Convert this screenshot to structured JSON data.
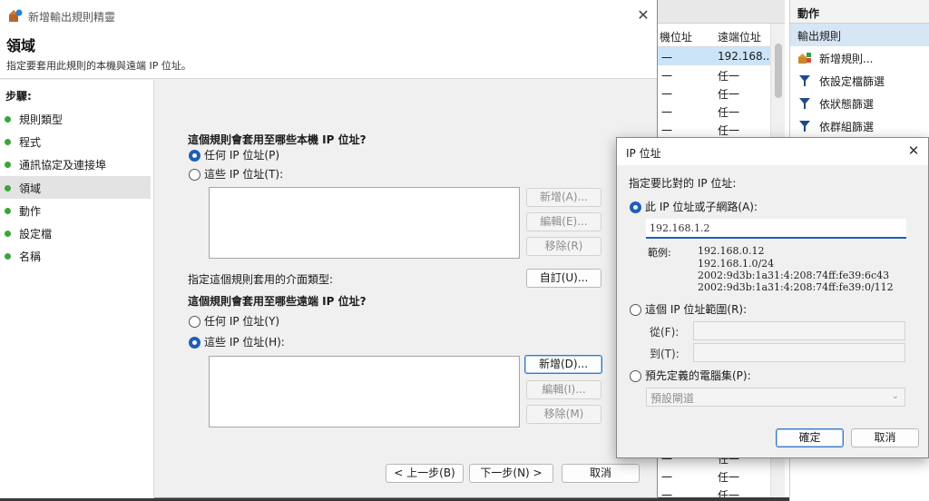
{
  "background": {
    "columns": [
      "機位址",
      "遠端位址"
    ],
    "rows": [
      {
        "local": "一",
        "remote": "192.168....",
        "selected": true
      },
      {
        "local": "一",
        "remote": "任一"
      },
      {
        "local": "一",
        "remote": "任一"
      },
      {
        "local": "一",
        "remote": "任一"
      },
      {
        "local": "一",
        "remote": "任一"
      }
    ],
    "bottom_rows": [
      {
        "local": "一",
        "remote": "任一"
      },
      {
        "local": "一",
        "remote": "任一"
      },
      {
        "local": "一",
        "remote": "任一"
      }
    ],
    "actions": {
      "title": "動作",
      "section": "輸出規則",
      "items": [
        {
          "label": "新增規則...",
          "icon": "new-rule-icon"
        },
        {
          "label": "依設定檔篩選",
          "icon": "filter-icon"
        },
        {
          "label": "依狀態篩選",
          "icon": "filter-icon"
        },
        {
          "label": "依群組篩選",
          "icon": "filter-icon"
        }
      ]
    }
  },
  "wizard": {
    "title": "新增輸出規則精靈",
    "heading": "領域",
    "subtitle": "指定要套用此規則的本機與遠端 IP 位址。",
    "steps_title": "步驟:",
    "steps": [
      "規則類型",
      "程式",
      "通訊協定及連接埠",
      "領域",
      "動作",
      "設定檔",
      "名稱"
    ],
    "active_step": 3,
    "local_heading": "這個規則會套用至哪些本機 IP 位址?",
    "local_any": "任何 IP 位址(P)",
    "local_these": "這些 IP 位址(T):",
    "local_selected": "any",
    "add_label": "新增(A)...",
    "edit_label": "編輯(E)...",
    "remove_label": "移除(R)",
    "interface_label": "指定這個規則套用的介面類型:",
    "customize_label": "自訂(U)...",
    "remote_heading": "這個規則會套用至哪些遠端 IP 位址?",
    "remote_any": "任何 IP 位址(Y)",
    "remote_these": "這些 IP 位址(H):",
    "remote_selected": "these",
    "remote_add_label": "新增(D)...",
    "remote_edit_label": "編輯(I)...",
    "remote_remove_label": "移除(M)",
    "back_label": "< 上一步(B)",
    "next_label": "下一步(N) >",
    "cancel_label": "取消"
  },
  "ip_dialog": {
    "title": "IP 位址",
    "prompt": "指定要比對的 IP 位址:",
    "option_address": "此 IP 位址或子網路(A):",
    "address_value": "192.168.1.2",
    "examples_label": "範例:",
    "examples": [
      "192.168.0.12",
      "192.168.1.0/24",
      "2002:9d3b:1a31:4:208:74ff:fe39:6c43",
      "2002:9d3b:1a31:4:208:74ff:fe39:0/112"
    ],
    "option_range": "這個 IP 位址範圍(R):",
    "from_label": "從(F):",
    "to_label": "到(T):",
    "option_predefined": "預先定義的電腦集(P):",
    "predefined_value": "預設閘道",
    "ok_label": "確定",
    "cancel_label": "取消",
    "selected_option": "address"
  },
  "colors": {
    "accent": "#1d5fb8",
    "step_dot": "#3aa53a",
    "selection": "#cce4f7"
  }
}
